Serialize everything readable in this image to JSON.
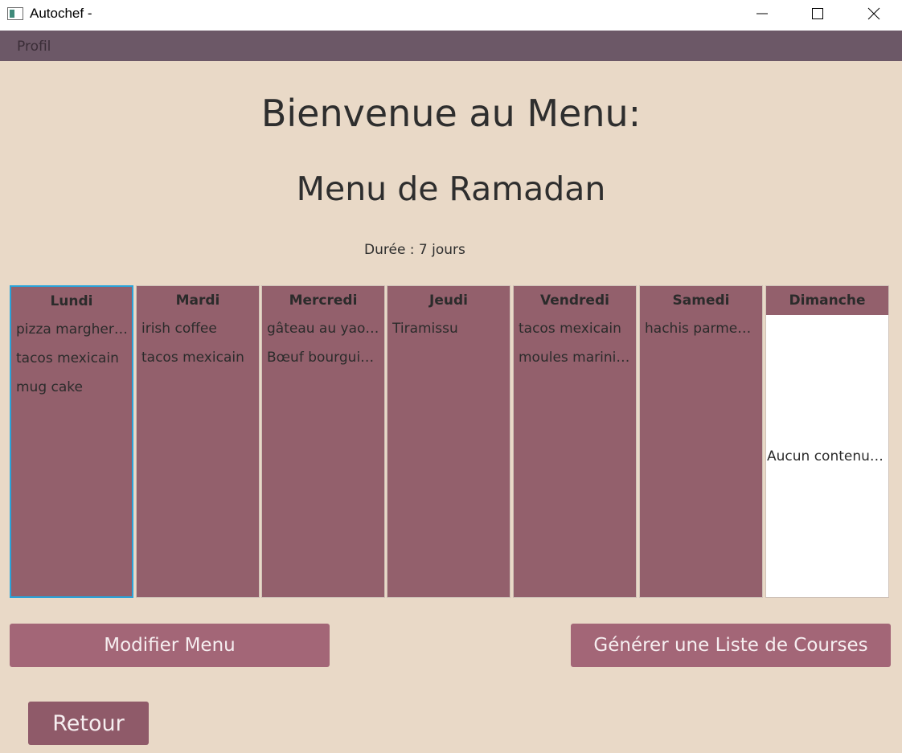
{
  "window": {
    "title": "Autochef -",
    "controls": {
      "minimize": "minimize-icon",
      "maximize": "maximize-icon",
      "close": "close-icon"
    }
  },
  "menubar": {
    "items": [
      "Profil"
    ]
  },
  "page": {
    "title": "Bienvenue au Menu:",
    "menu_name": "Menu de Ramadan",
    "duration": "Durée : 7 jours"
  },
  "days": [
    {
      "name": "Lundi",
      "dishes": [
        "pizza margherita",
        "tacos mexicain",
        "mug cake"
      ]
    },
    {
      "name": "Mardi",
      "dishes": [
        "irish coffee",
        "tacos mexicain"
      ]
    },
    {
      "name": "Mercredi",
      "dishes": [
        "gâteau au yaourt",
        "Bœuf bourguignon"
      ]
    },
    {
      "name": "Jeudi",
      "dishes": [
        "Tiramissu"
      ]
    },
    {
      "name": "Vendredi",
      "dishes": [
        "tacos mexicain",
        "moules marinières"
      ]
    },
    {
      "name": "Samedi",
      "dishes": [
        "hachis parmentier"
      ]
    },
    {
      "name": "Dimanche",
      "dishes": [],
      "empty_text": "Aucun contenu dans la table"
    }
  ],
  "buttons": {
    "modify": "Modifier Menu",
    "generate": "Générer une Liste de Courses",
    "back": "Retour"
  },
  "colors": {
    "background": "#e9d9c7",
    "menubar": "#6c5867",
    "day_column": "#93606c",
    "selected_border": "#2aa3d9",
    "button": "#a36677",
    "button_back": "#8f5a69"
  }
}
